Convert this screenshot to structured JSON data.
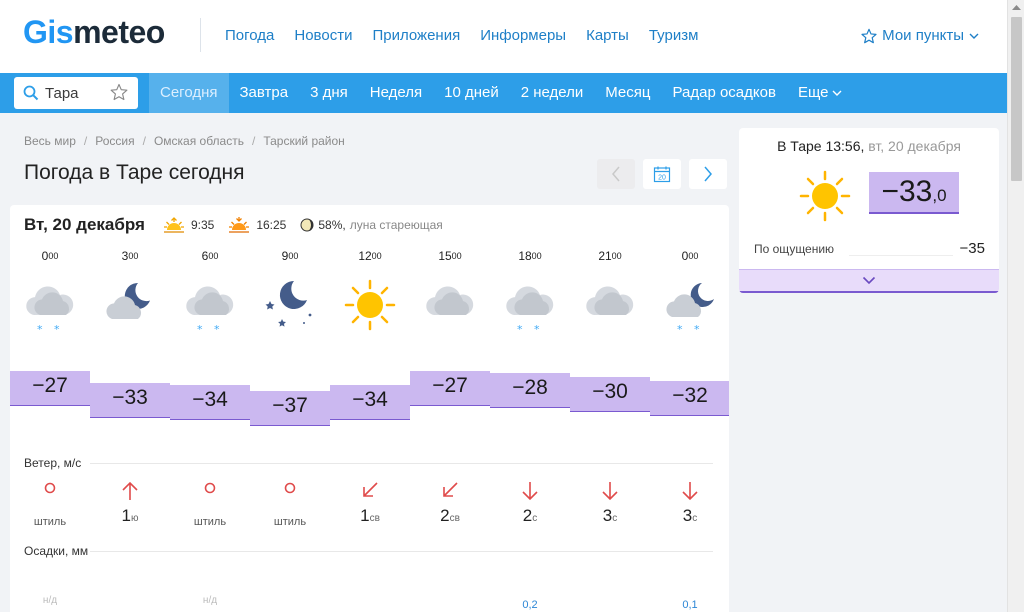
{
  "header": {
    "logo_part1": "Gis",
    "logo_part2": "meteo",
    "nav": [
      "Погода",
      "Новости",
      "Приложения",
      "Информеры",
      "Карты",
      "Туризм"
    ],
    "my_points": "Мои пункты"
  },
  "search": {
    "value": "Тара"
  },
  "bluenav": {
    "items": [
      "Сегодня",
      "Завтра",
      "3 дня",
      "Неделя",
      "10 дней",
      "2 недели",
      "Месяц",
      "Радар осадков"
    ],
    "more": "Еще"
  },
  "breadcrumb": [
    "Весь мир",
    "Россия",
    "Омская область",
    "Тарский район"
  ],
  "page_title": "Погода в Таре сегодня",
  "calendar_day": "20",
  "day": {
    "date": "Вт, 20 декабря",
    "sunrise": "9:35",
    "sunset": "16:25",
    "moon_pct": "58%,",
    "moon_phase": "луна стареющая"
  },
  "hours": [
    {
      "h": "0",
      "m": "00",
      "icon": "cloud-snow",
      "temp": -27,
      "wind_icon": "calm",
      "wind_speed": "",
      "wind_text": "штиль",
      "wind_dir": "",
      "precip": "н/д"
    },
    {
      "h": "3",
      "m": "00",
      "icon": "moon-cloud",
      "temp": -33,
      "wind_icon": "arrow-up",
      "wind_speed": "1",
      "wind_text": "",
      "wind_dir": "ю",
      "precip": ""
    },
    {
      "h": "6",
      "m": "00",
      "icon": "cloud-snow",
      "temp": -34,
      "wind_icon": "calm",
      "wind_speed": "",
      "wind_text": "штиль",
      "wind_dir": "",
      "precip": "н/д"
    },
    {
      "h": "9",
      "m": "00",
      "icon": "moon-stars",
      "temp": -37,
      "wind_icon": "calm",
      "wind_speed": "",
      "wind_text": "штиль",
      "wind_dir": "",
      "precip": ""
    },
    {
      "h": "12",
      "m": "00",
      "icon": "sun",
      "temp": -34,
      "wind_icon": "arrow-down-left",
      "wind_speed": "1",
      "wind_text": "",
      "wind_dir": "св",
      "precip": ""
    },
    {
      "h": "15",
      "m": "00",
      "icon": "cloud",
      "temp": -27,
      "wind_icon": "arrow-down-left",
      "wind_speed": "2",
      "wind_text": "",
      "wind_dir": "св",
      "precip": ""
    },
    {
      "h": "18",
      "m": "00",
      "icon": "cloud-snow",
      "temp": -28,
      "wind_icon": "arrow-down",
      "wind_speed": "2",
      "wind_text": "",
      "wind_dir": "с",
      "precip": "0,2"
    },
    {
      "h": "21",
      "m": "00",
      "icon": "cloud",
      "temp": -30,
      "wind_icon": "arrow-down",
      "wind_speed": "3",
      "wind_text": "",
      "wind_dir": "с",
      "precip": ""
    },
    {
      "h": "0",
      "m": "00",
      "icon": "moon-cloud-snow",
      "temp": -32,
      "wind_icon": "arrow-down",
      "wind_speed": "3",
      "wind_text": "",
      "wind_dir": "с",
      "precip": "0,1"
    }
  ],
  "labels": {
    "wind": "Ветер, м/с",
    "precip": "Осадки, мм"
  },
  "current": {
    "title": "В Таре 13:56,",
    "date": "вт, 20 декабря",
    "temp_int": "−33",
    "temp_dec": ",0",
    "feels_label": "По ощущению",
    "feels_value": "−35"
  },
  "colors": {
    "accent": "#2d9ee8",
    "temp_fill": "#cbb8f0",
    "temp_line": "#7a5ad0",
    "link": "#1e7fc7"
  }
}
